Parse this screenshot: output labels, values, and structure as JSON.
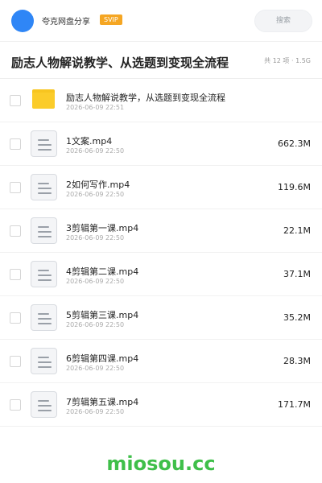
{
  "header": {
    "share_name": "夸克网盘分享",
    "badge": "SVIP",
    "search_placeholder": "搜索",
    "avatar_color": "#2f86f6"
  },
  "folder": {
    "title": "励志人物解说教学、从选题到变现全流程",
    "meta": "共 12 项 · 1.5G"
  },
  "items": [
    {
      "type": "folder",
      "name": "励志人物解说教学，从选题到变现全流程",
      "date": "2026-06-09 22:51",
      "size": ""
    },
    {
      "type": "file",
      "name": "1文案.mp4",
      "date": "2026-06-09 22:50",
      "size": "662.3M"
    },
    {
      "type": "file",
      "name": "2如何写作.mp4",
      "date": "2026-06-09 22:50",
      "size": "119.6M"
    },
    {
      "type": "file",
      "name": "3剪辑第一课.mp4",
      "date": "2026-06-09 22:50",
      "size": "22.1M"
    },
    {
      "type": "file",
      "name": "4剪辑第二课.mp4",
      "date": "2026-06-09 22:50",
      "size": "37.1M"
    },
    {
      "type": "file",
      "name": "5剪辑第三课.mp4",
      "date": "2026-06-09 22:50",
      "size": "35.2M"
    },
    {
      "type": "file",
      "name": "6剪辑第四课.mp4",
      "date": "2026-06-09 22:50",
      "size": "28.3M"
    },
    {
      "type": "file",
      "name": "7剪辑第五课.mp4",
      "date": "2026-06-09 22:50",
      "size": "171.7M"
    }
  ],
  "watermark": "miosou.cc",
  "colors": {
    "folder": "#fbcc2a",
    "svip": "#f5a623",
    "watermark": "#3fbf4a"
  }
}
